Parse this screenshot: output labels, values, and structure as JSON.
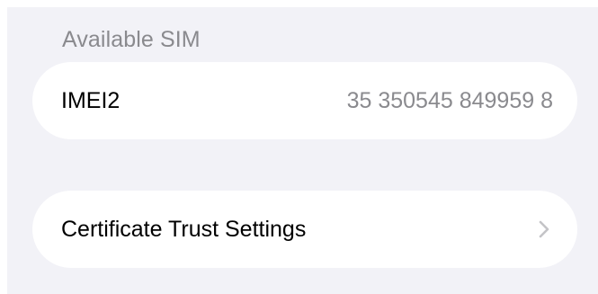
{
  "section": {
    "header": "Available SIM"
  },
  "imei_row": {
    "label": "IMEI2",
    "value": "35 350545 849959 8"
  },
  "certificate_row": {
    "label": "Certificate Trust Settings",
    "icon": "chevron-right-icon"
  },
  "colors": {
    "background": "#f2f2f7",
    "card": "#ffffff",
    "secondary_text": "#8a8a8e",
    "primary_text": "#000000",
    "chevron": "#c4c4c7"
  }
}
